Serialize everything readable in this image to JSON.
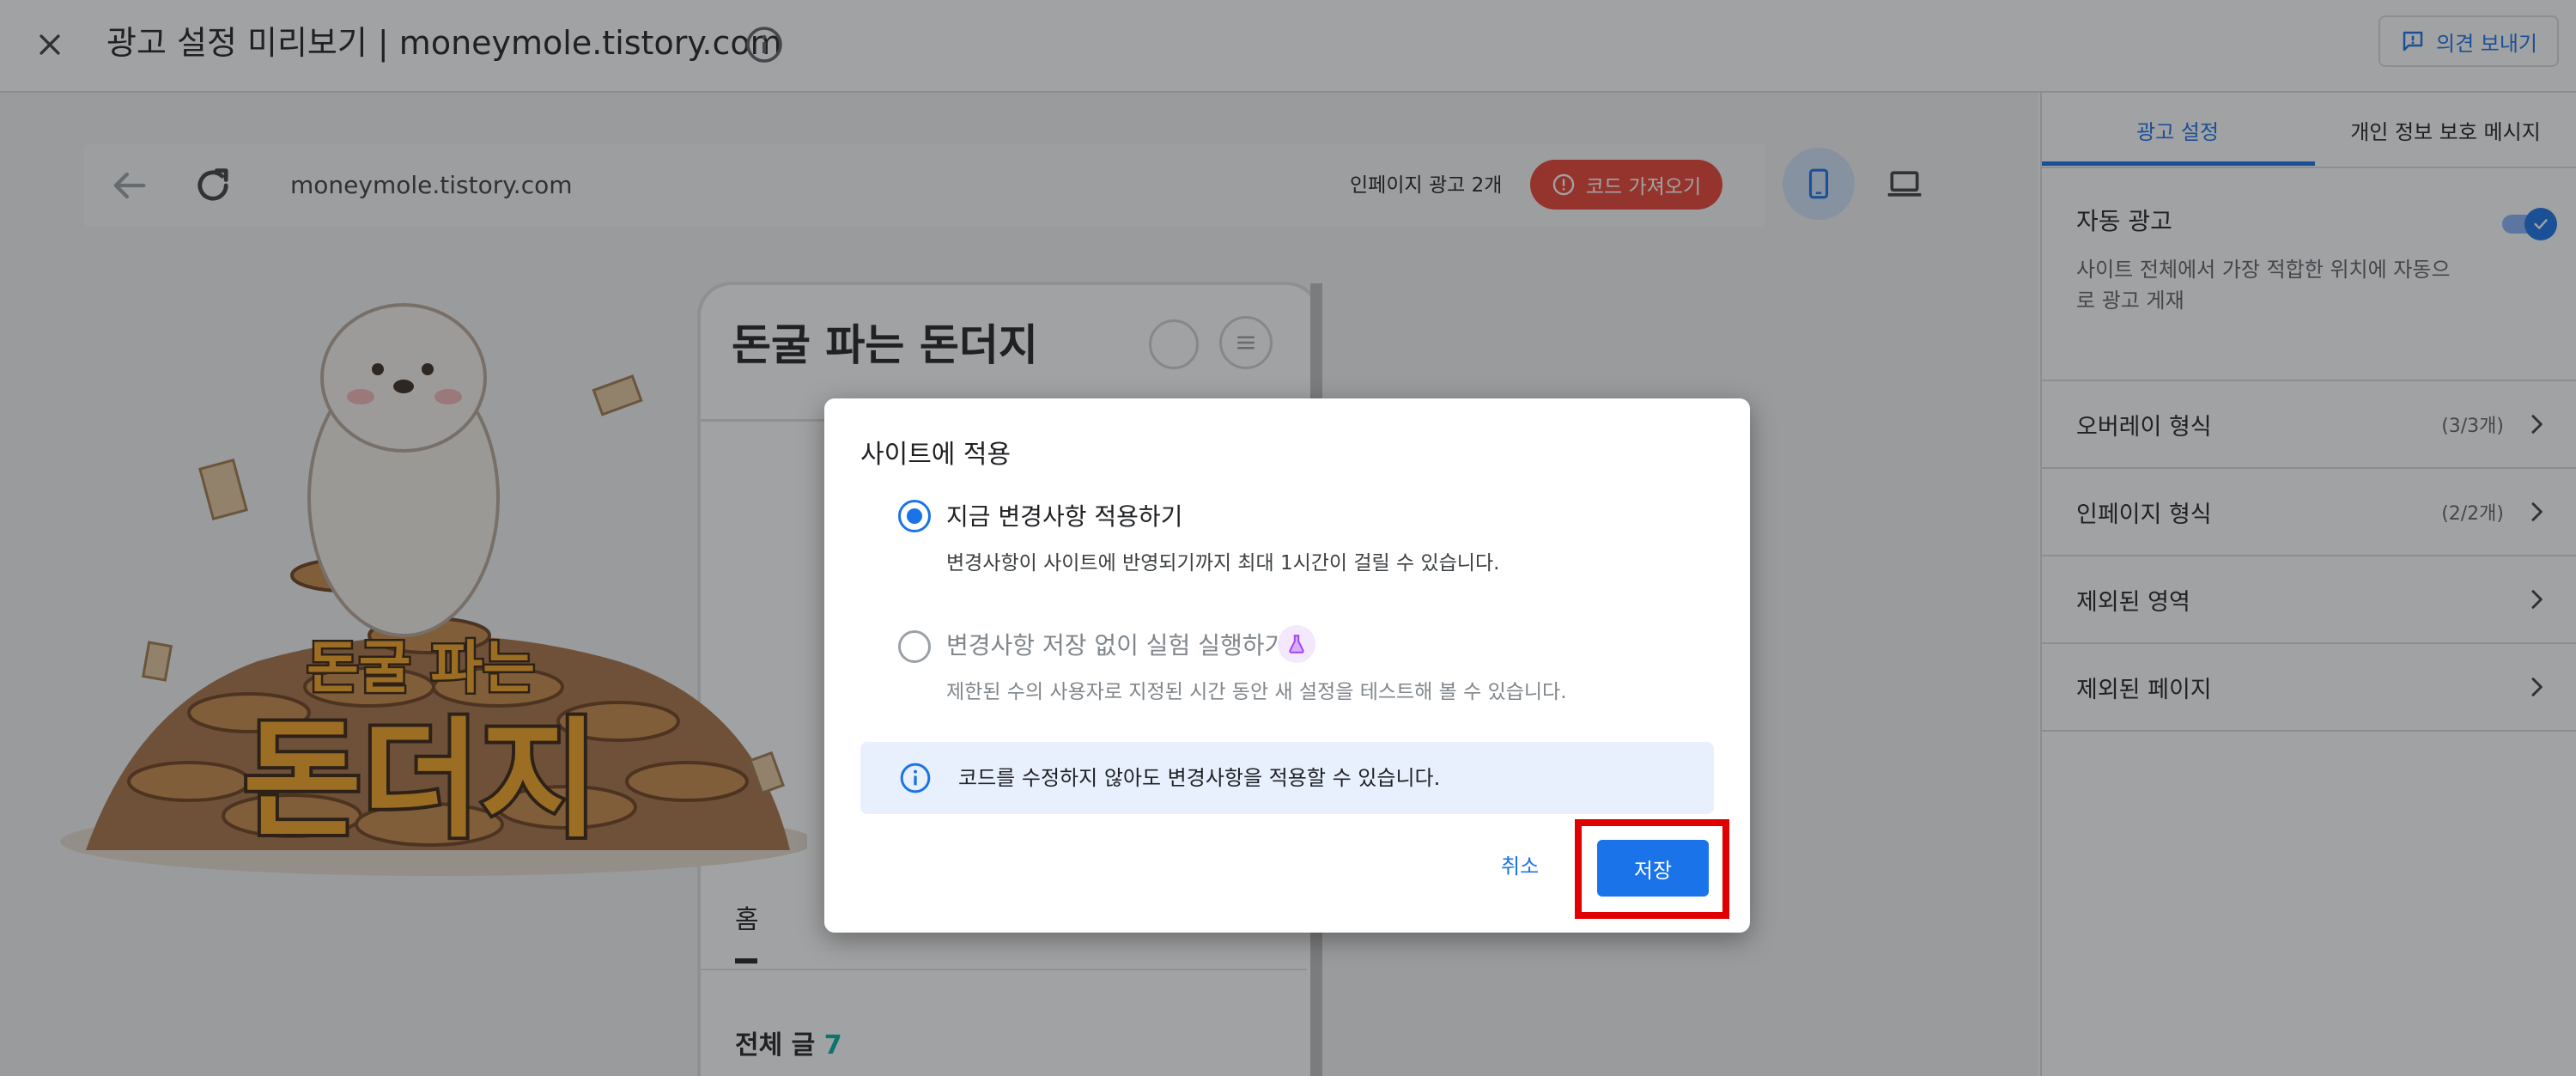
{
  "header": {
    "title": "광고 설정 미리보기 | moneymole.tistory.com",
    "close_icon": "close-icon",
    "info_icon": "info-icon",
    "feedback_label": "의견 보내기",
    "feedback_icon": "feedback-icon"
  },
  "preview": {
    "url": "moneymole.tistory.com",
    "inpage_ads_count": "인페이지 광고 2개",
    "get_code_label": "코드 가져오기",
    "blog_title": "돈굴 파는 돈더지",
    "mascot_text_top": "돈굴 파는",
    "mascot_text_bottom": "돈더지",
    "home_tab": "홈",
    "posts_label": "전체 글",
    "posts_count": "7"
  },
  "side_panel": {
    "tabs": [
      {
        "label": "광고 설정",
        "active": true
      },
      {
        "label": "개인 정보 보호 메시지",
        "active": false
      }
    ],
    "auto_ads": {
      "label": "자동 광고",
      "description": "사이트 전체에서 가장 적합한 위치에 자동으로 광고 게재",
      "enabled": true
    },
    "rows": [
      {
        "label": "오버레이 형식",
        "count": "(3/3개)"
      },
      {
        "label": "인페이지 형식",
        "count": "(2/2개)"
      },
      {
        "label": "제외된 영역",
        "count": ""
      },
      {
        "label": "제외된 페이지",
        "count": ""
      }
    ]
  },
  "dialog": {
    "title": "사이트에 적용",
    "options": [
      {
        "label": "지금 변경사항 적용하기",
        "description": "변경사항이 사이트에 반영되기까지 최대 1시간이 걸릴 수 있습니다.",
        "selected": true
      },
      {
        "label": "변경사항 저장 없이 실험 실행하기",
        "description": "제한된 수의 사용자로 지정된 시간 동안 새 설정을 테스트해 볼 수 있습니다.",
        "selected": false
      }
    ],
    "info_text": "코드를 수정하지 않아도 변경사항을 적용할 수 있습니다.",
    "cancel_label": "취소",
    "save_label": "저장"
  },
  "colors": {
    "accent": "#1a73e8",
    "danger": "#ea4335",
    "highlight": "#e00000",
    "posts_count": "#00b0a0"
  }
}
